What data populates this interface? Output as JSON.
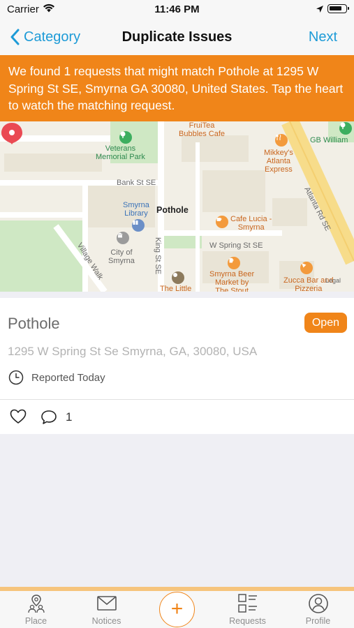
{
  "status_bar": {
    "carrier": "Carrier",
    "time": "11:46 PM"
  },
  "nav": {
    "back_label": "Category",
    "title": "Duplicate Issues",
    "next_label": "Next"
  },
  "banner": {
    "text": "We found 1 requests that might match Pothole at 1295 W Spring St SE, Smyrna GA 30080, United States. Tap the heart to watch the matching request."
  },
  "map": {
    "labels": {
      "veterans_park": "Veterans\nMemorial Park",
      "fruitea": "FruiTea\nBubbles Cafe",
      "mikkeys": "Mikkey's\nAtlanta\nExpress",
      "gb_william": "GB William",
      "atlanta_rd": "Atlanta Rd SE",
      "bank_st": "Bank St SE",
      "smyrna_library": "Smyrna\nLibrary",
      "pothole": "Pothole",
      "cafe_lucia": "Cafe Lucia -\nSmyrna",
      "city_of_smyrna": "City of\nSmyrna",
      "king_st": "King St SE",
      "w_spring_st": "W Spring St SE",
      "village_walk": "Village Walk",
      "smyrna_beer": "Smyrna Beer\nMarket by\nThe Stout",
      "zucca": "Zucca Bar and\nPizzeria",
      "the_little": "The Little",
      "legal": "Legal"
    },
    "colors": {
      "base": "#f2efe6",
      "park": "#cfe8c4",
      "road": "#ffffff",
      "highway": "#f7dc8a",
      "block": "#e9e4d6"
    }
  },
  "issue": {
    "title": "Pothole",
    "status": "Open",
    "address": "1295 W Spring St Se Smyrna, GA, 30080, USA",
    "reported": "Reported Today",
    "comment_count": "1"
  },
  "tab_bar": {
    "place": "Place",
    "notices": "Notices",
    "add": "+",
    "requests": "Requests",
    "profile": "Profile"
  },
  "theme": {
    "accent": "#f08519",
    "link": "#1e9bd7"
  }
}
